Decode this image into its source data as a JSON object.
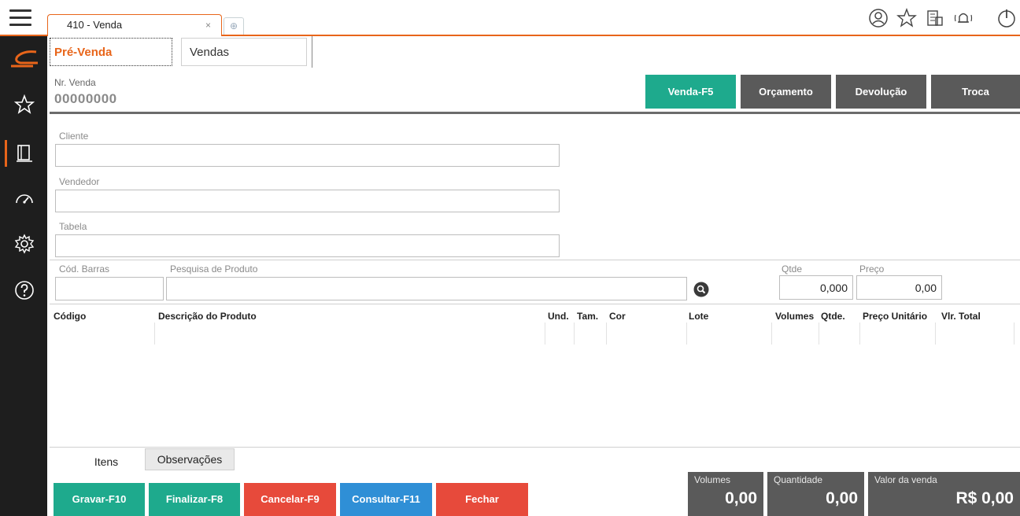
{
  "topbar": {
    "tab_title": "410 - Venda",
    "tab_close": "×",
    "icons": [
      "user-icon",
      "star-icon",
      "building-icon",
      "bell-icon",
      "power-icon"
    ]
  },
  "sidebar": {
    "icons": [
      "logo-icon",
      "star-icon",
      "book-icon",
      "speedometer-icon",
      "gear-icon",
      "help-icon"
    ]
  },
  "subtabs": {
    "pre_venda": "Pré-Venda",
    "vendas": "Vendas"
  },
  "header": {
    "nr_label": "Nr. Venda",
    "nr_value": "00000000",
    "modes": {
      "venda": "Venda-F5",
      "orcamento": "Orçamento",
      "devolucao": "Devolução",
      "troca": "Troca"
    }
  },
  "form": {
    "cliente_label": "Cliente",
    "vendedor_label": "Vendedor",
    "tabela_label": "Tabela",
    "codbarras_label": "Cód. Barras",
    "pesquisa_label": "Pesquisa de Produto",
    "qtde_label": "Qtde",
    "qtde_value": "0,000",
    "preco_label": "Preço",
    "preco_value": "0,00"
  },
  "grid": {
    "columns": [
      "Código",
      "Descrição do Produto",
      "Und.",
      "Tam.",
      "Cor",
      "Lote",
      "Volumes",
      "Qtde.",
      "Preço Unitário",
      "Vlr. Total"
    ]
  },
  "bottom_tabs": {
    "itens": "Itens",
    "observacoes": "Observações"
  },
  "actions": {
    "gravar": "Gravar-F10",
    "finalizar": "Finalizar-F8",
    "cancelar": "Cancelar-F9",
    "consultar": "Consultar-F11",
    "fechar": "Fechar"
  },
  "totals": {
    "volumes_label": "Volumes",
    "volumes_value": "0,00",
    "quantidade_label": "Quantidade",
    "quantidade_value": "0,00",
    "valor_label": "Valor da venda",
    "valor_value": "R$ 0,00"
  },
  "colors": {
    "accent": "#e8651a",
    "green": "#1eaa8d",
    "red": "#e74a3b",
    "blue": "#2f8fd6",
    "dark": "#5a5a5a"
  }
}
